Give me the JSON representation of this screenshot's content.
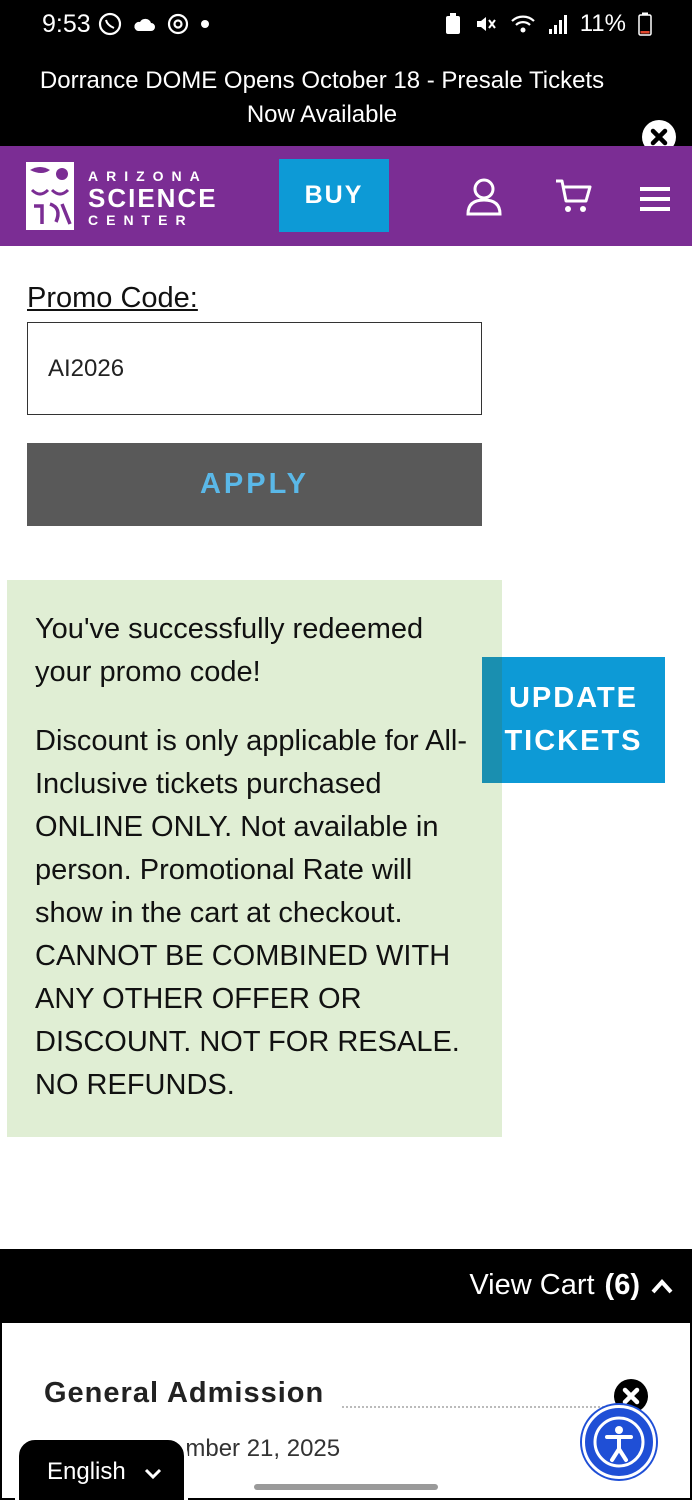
{
  "status_bar": {
    "time": "9:53",
    "battery": "11%"
  },
  "announcement": {
    "text": "Dorrance DOME Opens October 18 - Presale Tickets Now Available"
  },
  "header": {
    "logo_line1": "ARIZONA",
    "logo_line2": "SCIENCE",
    "logo_line3": "CENTER",
    "buy_label": "BUY"
  },
  "promo": {
    "label": "Promo Code:",
    "value": "AI2026",
    "apply_label": "APPLY"
  },
  "success": {
    "title": "You've successfully redeemed your promo code!",
    "details": "Discount is only applicable for All-Inclusive tickets purchased ONLINE ONLY. Not available in person. Promotional Rate will show in the cart at checkout. CANNOT BE COMBINED WITH ANY OTHER OFFER OR DISCOUNT. NOT FOR RESALE. NO REFUNDS."
  },
  "update_button": {
    "line1": "UPDATE",
    "line2": "TICKETS"
  },
  "cart": {
    "label": "View Cart",
    "count": "(6)",
    "item_title": "General Admission",
    "item_date": "ember 21, 2025"
  },
  "language": {
    "selected": "English"
  },
  "colors": {
    "header_purple": "#7b2d94",
    "accent_blue": "#0d9ad6",
    "success_green": "#e0eed4",
    "apply_gray": "#595959"
  }
}
